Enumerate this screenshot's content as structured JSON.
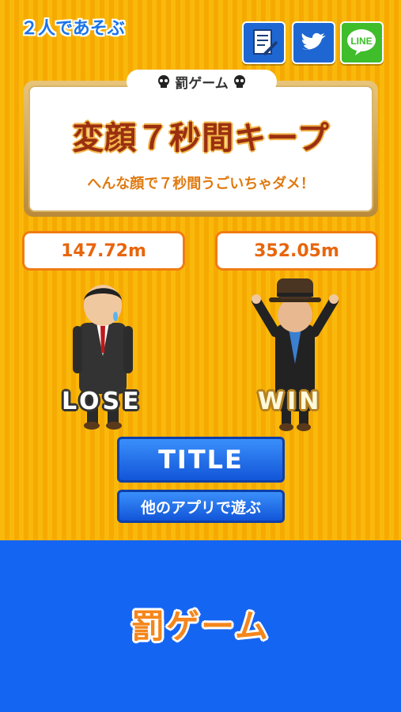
{
  "header": {
    "mode_label": "２人であそぶ",
    "share_buttons": [
      {
        "icon": "memo-icon",
        "color": "#1e67d2"
      },
      {
        "icon": "twitter-icon",
        "color": "#1e67d2"
      },
      {
        "icon": "line-icon",
        "label": "LINE",
        "color": "#3fbd2b"
      }
    ]
  },
  "penalty": {
    "heading": "罰ゲーム",
    "name": "変顔７秒間キープ",
    "description": "へんな顔で７秒間うごいちゃダメ！"
  },
  "players": [
    {
      "distance": "147.72m",
      "result": "LOSE"
    },
    {
      "distance": "352.05m",
      "result": "WIN"
    }
  ],
  "buttons": {
    "title": "TITLE",
    "other_apps": "他のアプリで遊ぶ"
  },
  "banner": {
    "text": "罰ゲーム"
  },
  "colors": {
    "background_stripe_a": "#f9b90b",
    "background_stripe_b": "#f6a903",
    "banner_blue": "#1565f3",
    "score_orange": "#e8650c",
    "button_blue": "#1f6fe8"
  }
}
